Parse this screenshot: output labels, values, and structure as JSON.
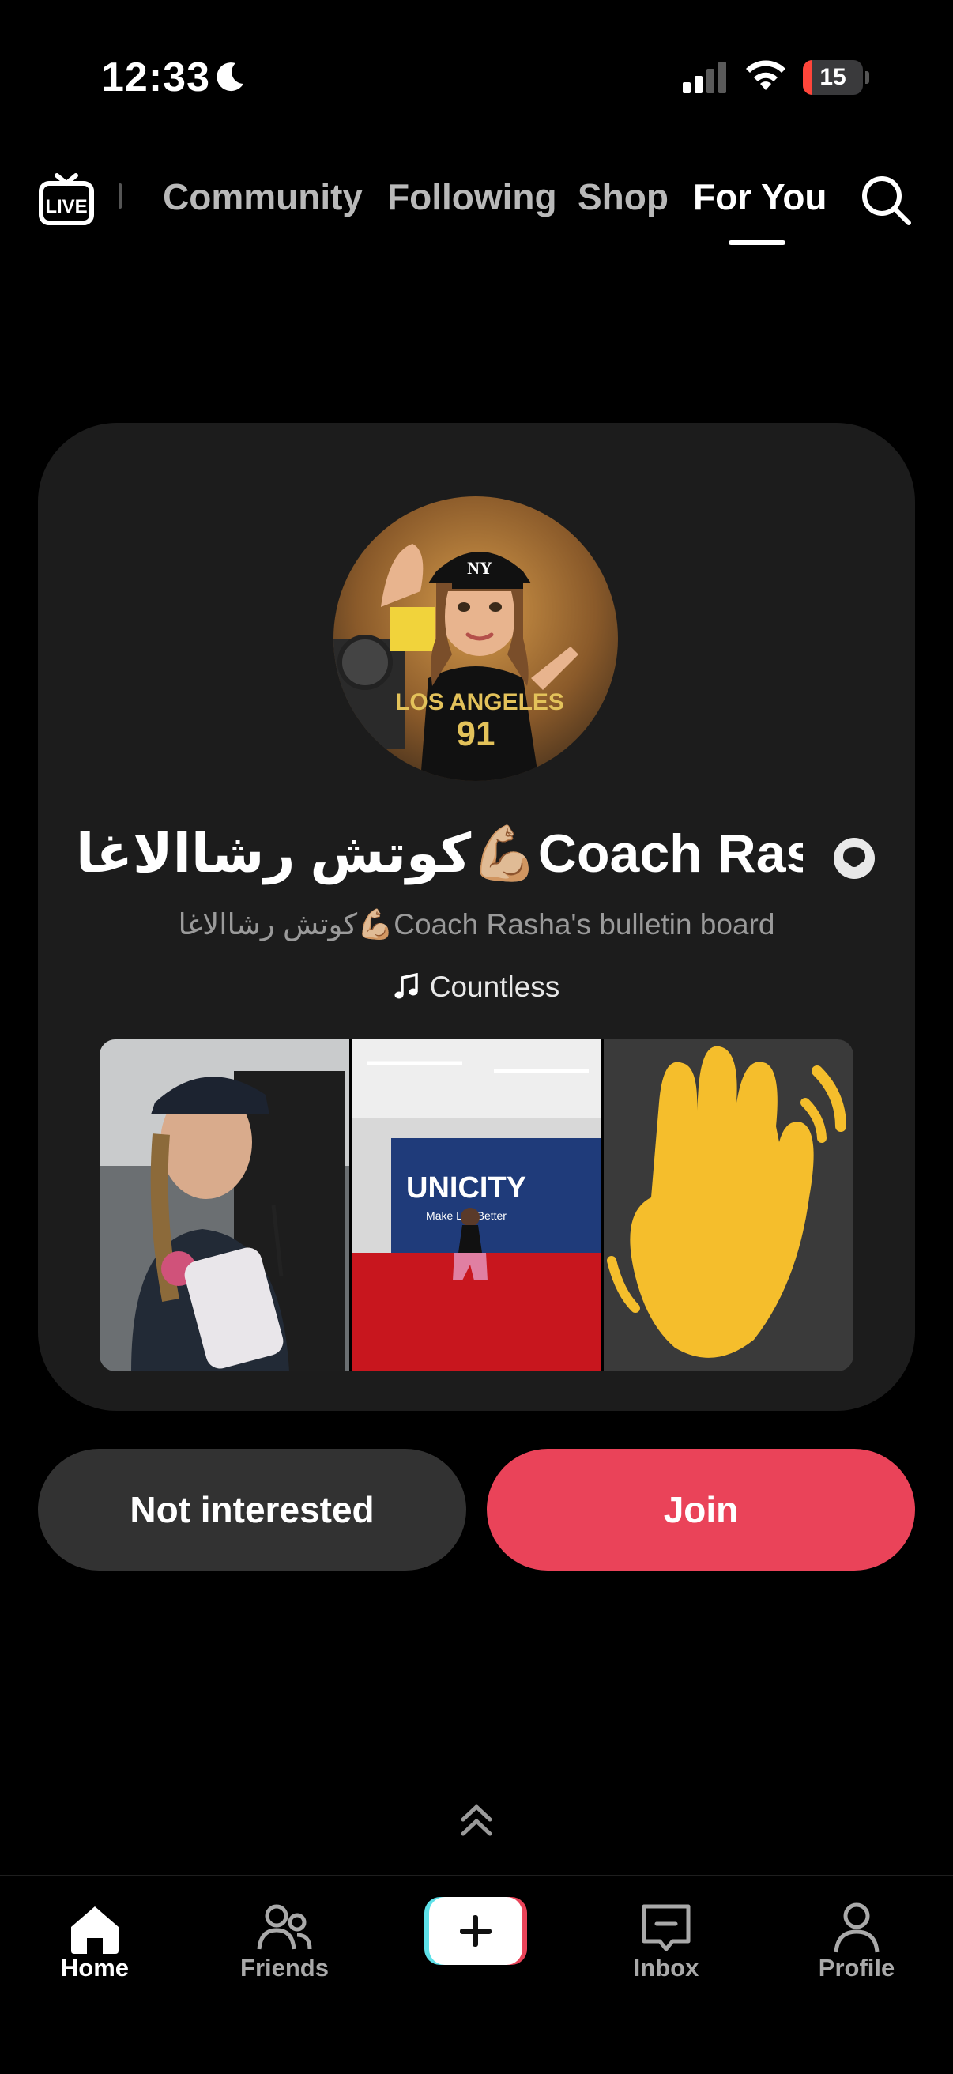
{
  "status_bar": {
    "time": "12:33",
    "battery": "15",
    "battery_level": 0.15
  },
  "top_nav": {
    "tabs": [
      {
        "label": "Community"
      },
      {
        "label": "Following"
      },
      {
        "label": "Shop"
      },
      {
        "label": "For You",
        "active": true
      }
    ],
    "live_icon": "live-tv-icon",
    "search_icon": "search-icon"
  },
  "card": {
    "title": "كوتش رشاالاغا💪🏼Coach Ras...",
    "subtitle": "كوتش رشاالاغا💪🏼Coach Rasha's bulletin board",
    "music": "Countless"
  },
  "buttons": {
    "not_interested": "Not interested",
    "join": "Join"
  },
  "bottom_nav": {
    "items": [
      {
        "label": "Home",
        "icon": "home-icon",
        "active": true
      },
      {
        "label": "Friends",
        "icon": "friends-icon"
      },
      {
        "label": "",
        "icon": "create-plus-icon"
      },
      {
        "label": "Inbox",
        "icon": "inbox-icon"
      },
      {
        "label": "Profile",
        "icon": "profile-icon"
      }
    ]
  },
  "colors": {
    "accent": "#ea4359",
    "card_bg": "#1c1c1c",
    "secondary_button": "#323232"
  }
}
